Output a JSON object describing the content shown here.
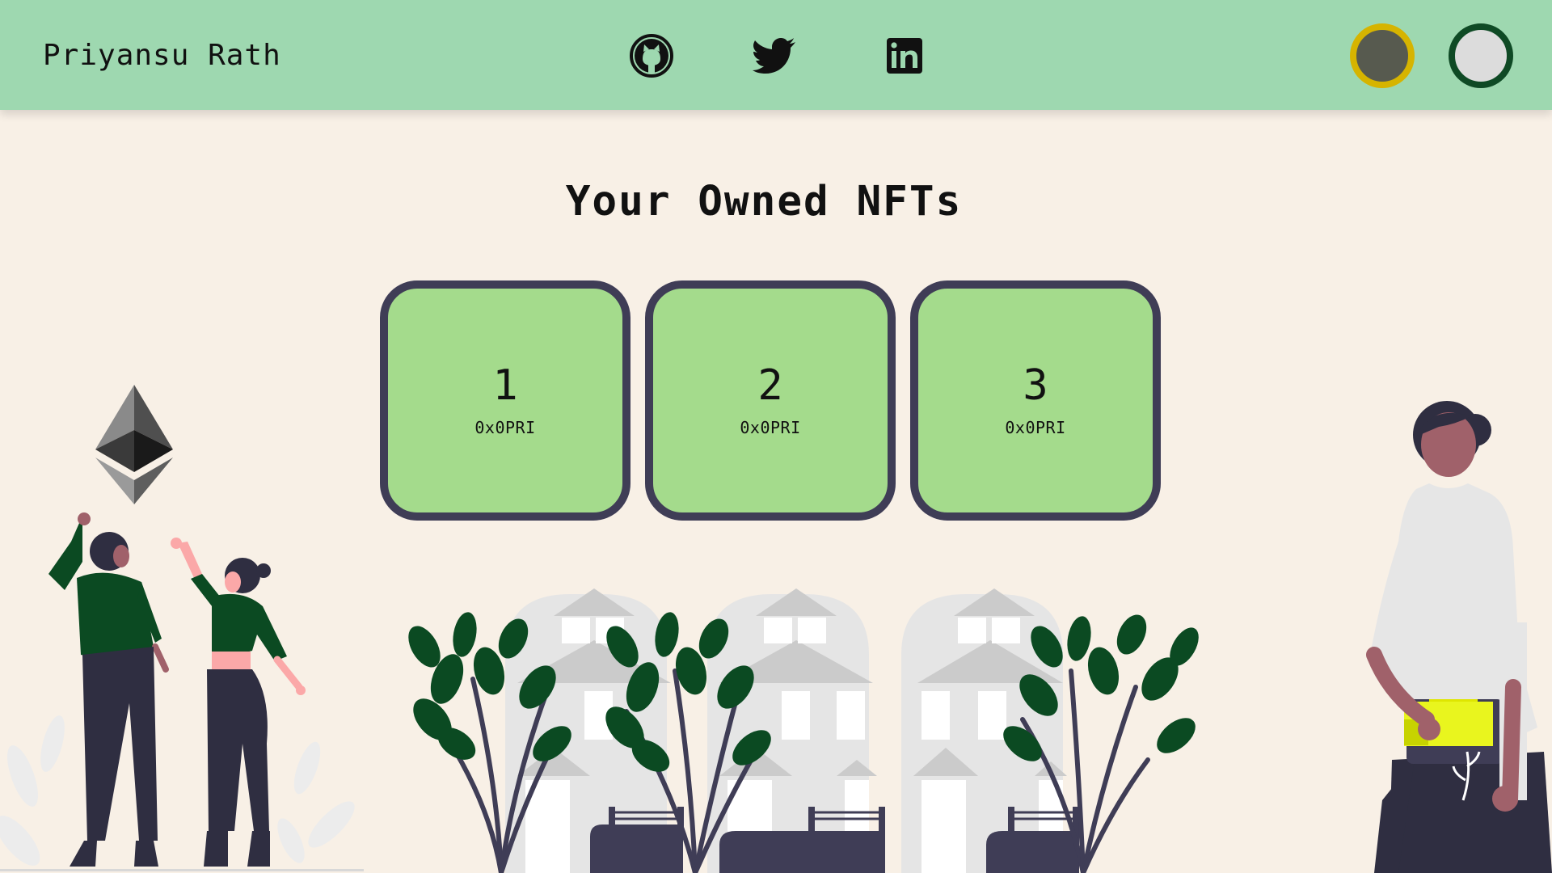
{
  "header": {
    "brand": "Priyansu Rath",
    "socials": [
      {
        "icon": "github-icon"
      },
      {
        "icon": "twitter-icon"
      },
      {
        "icon": "linkedin-icon"
      }
    ],
    "theme_toggles": [
      {
        "fill": "#575a4f",
        "ring": "#d6b400"
      },
      {
        "fill": "#dcdcdc",
        "ring": "#0f4a25"
      }
    ]
  },
  "main": {
    "title": "Your Owned NFTs",
    "nfts": [
      {
        "id": "1",
        "symbol": "0x0PRI"
      },
      {
        "id": "2",
        "symbol": "0x0PRI"
      },
      {
        "id": "3",
        "symbol": "0x0PRI"
      }
    ]
  },
  "colors": {
    "header_bg": "#9ed8b0",
    "page_bg": "#f8f0e6",
    "card_fill": "#a4db8c",
    "card_border": "#3f3d56",
    "accent_green": "#0b4a22"
  }
}
